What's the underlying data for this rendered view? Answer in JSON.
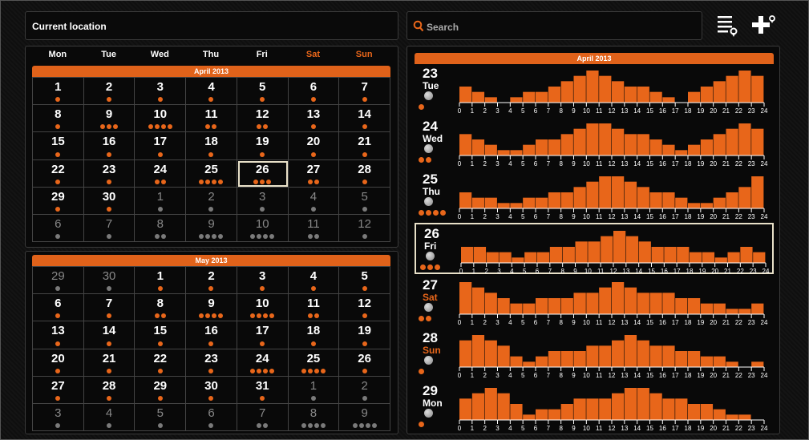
{
  "header": {
    "location_label": "Current location",
    "search_placeholder": "Search"
  },
  "calendar": {
    "weekdays": [
      "Mon",
      "Tue",
      "Wed",
      "Thu",
      "Fri",
      "Sat",
      "Sun"
    ],
    "weekend_color": "#e8661a",
    "april": {
      "title": "April 2013",
      "cells": [
        {
          "d": "1",
          "n": 1,
          "o": false
        },
        {
          "d": "2",
          "n": 1,
          "o": false
        },
        {
          "d": "3",
          "n": 1,
          "o": false
        },
        {
          "d": "4",
          "n": 1,
          "o": false
        },
        {
          "d": "5",
          "n": 1,
          "o": false
        },
        {
          "d": "6",
          "n": 1,
          "o": false
        },
        {
          "d": "7",
          "n": 1,
          "o": false
        },
        {
          "d": "8",
          "n": 1,
          "o": false
        },
        {
          "d": "9",
          "n": 3,
          "o": false
        },
        {
          "d": "10",
          "n": 4,
          "o": false
        },
        {
          "d": "11",
          "n": 2,
          "o": false
        },
        {
          "d": "12",
          "n": 2,
          "o": false
        },
        {
          "d": "13",
          "n": 1,
          "o": false
        },
        {
          "d": "14",
          "n": 1,
          "o": false
        },
        {
          "d": "15",
          "n": 1,
          "o": false
        },
        {
          "d": "16",
          "n": 1,
          "o": false
        },
        {
          "d": "17",
          "n": 1,
          "o": false
        },
        {
          "d": "18",
          "n": 1,
          "o": false
        },
        {
          "d": "19",
          "n": 1,
          "o": false
        },
        {
          "d": "20",
          "n": 1,
          "o": false
        },
        {
          "d": "21",
          "n": 1,
          "o": false
        },
        {
          "d": "22",
          "n": 1,
          "o": false
        },
        {
          "d": "23",
          "n": 1,
          "o": false
        },
        {
          "d": "24",
          "n": 2,
          "o": false
        },
        {
          "d": "25",
          "n": 4,
          "o": false
        },
        {
          "d": "26",
          "n": 3,
          "o": false,
          "sel": true
        },
        {
          "d": "27",
          "n": 2,
          "o": false
        },
        {
          "d": "28",
          "n": 1,
          "o": false
        },
        {
          "d": "29",
          "n": 1,
          "o": false
        },
        {
          "d": "30",
          "n": 1,
          "o": false
        },
        {
          "d": "1",
          "n": 1,
          "o": true
        },
        {
          "d": "2",
          "n": 1,
          "o": true
        },
        {
          "d": "3",
          "n": 1,
          "o": true
        },
        {
          "d": "4",
          "n": 1,
          "o": true
        },
        {
          "d": "5",
          "n": 1,
          "o": true
        },
        {
          "d": "6",
          "n": 1,
          "o": true
        },
        {
          "d": "7",
          "n": 1,
          "o": true
        },
        {
          "d": "8",
          "n": 2,
          "o": true
        },
        {
          "d": "9",
          "n": 4,
          "o": true
        },
        {
          "d": "10",
          "n": 4,
          "o": true
        },
        {
          "d": "11",
          "n": 2,
          "o": true
        },
        {
          "d": "12",
          "n": 1,
          "o": true
        }
      ]
    },
    "may": {
      "title": "May 2013",
      "cells": [
        {
          "d": "29",
          "n": 1,
          "o": true
        },
        {
          "d": "30",
          "n": 1,
          "o": true
        },
        {
          "d": "1",
          "n": 1,
          "o": false
        },
        {
          "d": "2",
          "n": 1,
          "o": false
        },
        {
          "d": "3",
          "n": 1,
          "o": false
        },
        {
          "d": "4",
          "n": 1,
          "o": false
        },
        {
          "d": "5",
          "n": 1,
          "o": false
        },
        {
          "d": "6",
          "n": 1,
          "o": false
        },
        {
          "d": "7",
          "n": 1,
          "o": false
        },
        {
          "d": "8",
          "n": 2,
          "o": false
        },
        {
          "d": "9",
          "n": 4,
          "o": false
        },
        {
          "d": "10",
          "n": 4,
          "o": false
        },
        {
          "d": "11",
          "n": 2,
          "o": false
        },
        {
          "d": "12",
          "n": 1,
          "o": false
        },
        {
          "d": "13",
          "n": 1,
          "o": false
        },
        {
          "d": "14",
          "n": 1,
          "o": false
        },
        {
          "d": "15",
          "n": 1,
          "o": false
        },
        {
          "d": "16",
          "n": 1,
          "o": false
        },
        {
          "d": "17",
          "n": 1,
          "o": false
        },
        {
          "d": "18",
          "n": 1,
          "o": false
        },
        {
          "d": "19",
          "n": 1,
          "o": false
        },
        {
          "d": "20",
          "n": 1,
          "o": false
        },
        {
          "d": "21",
          "n": 1,
          "o": false
        },
        {
          "d": "22",
          "n": 1,
          "o": false
        },
        {
          "d": "23",
          "n": 1,
          "o": false
        },
        {
          "d": "24",
          "n": 4,
          "o": false
        },
        {
          "d": "25",
          "n": 4,
          "o": false
        },
        {
          "d": "26",
          "n": 1,
          "o": false
        },
        {
          "d": "27",
          "n": 1,
          "o": false
        },
        {
          "d": "28",
          "n": 1,
          "o": false
        },
        {
          "d": "29",
          "n": 1,
          "o": false
        },
        {
          "d": "30",
          "n": 1,
          "o": false
        },
        {
          "d": "31",
          "n": 1,
          "o": false
        },
        {
          "d": "1",
          "n": 1,
          "o": true
        },
        {
          "d": "2",
          "n": 1,
          "o": true
        },
        {
          "d": "3",
          "n": 1,
          "o": true
        },
        {
          "d": "4",
          "n": 1,
          "o": true
        },
        {
          "d": "5",
          "n": 1,
          "o": true
        },
        {
          "d": "6",
          "n": 1,
          "o": true
        },
        {
          "d": "7",
          "n": 2,
          "o": true
        },
        {
          "d": "8",
          "n": 4,
          "o": true
        },
        {
          "d": "9",
          "n": 4,
          "o": true
        }
      ]
    }
  },
  "day_charts": {
    "title": "April 2013",
    "bar_color": "#e8661a",
    "hours": [
      "0",
      "1",
      "2",
      "3",
      "4",
      "5",
      "6",
      "7",
      "8",
      "9",
      "10",
      "11",
      "12",
      "13",
      "14",
      "15",
      "16",
      "17",
      "18",
      "19",
      "20",
      "21",
      "22",
      "23",
      "24"
    ],
    "days": [
      {
        "num": "23",
        "name": "Tue",
        "weekend": false,
        "dots": 1,
        "values": [
          3,
          2,
          1,
          0,
          1,
          2,
          2,
          3,
          4,
          5,
          6,
          5,
          4,
          3,
          3,
          2,
          1,
          0,
          2,
          3,
          4,
          5,
          6,
          5
        ]
      },
      {
        "num": "24",
        "name": "Wed",
        "weekend": false,
        "dots": 2,
        "values": [
          4,
          3,
          2,
          1,
          1,
          2,
          3,
          3,
          4,
          5,
          6,
          6,
          5,
          4,
          4,
          3,
          2,
          1,
          2,
          3,
          4,
          5,
          6,
          5
        ]
      },
      {
        "num": "25",
        "name": "Thu",
        "weekend": false,
        "dots": 4,
        "values": [
          3,
          2,
          2,
          1,
          1,
          2,
          2,
          3,
          3,
          4,
          5,
          6,
          6,
          5,
          4,
          3,
          3,
          2,
          1,
          1,
          2,
          3,
          4,
          6
        ]
      },
      {
        "num": "26",
        "name": "Fri",
        "weekend": false,
        "dots": 3,
        "values": [
          3,
          3,
          2,
          2,
          1,
          2,
          2,
          3,
          3,
          4,
          4,
          5,
          6,
          5,
          4,
          3,
          3,
          3,
          2,
          2,
          1,
          2,
          3,
          2
        ]
      },
      {
        "num": "27",
        "name": "Sat",
        "weekend": true,
        "dots": 2,
        "values": [
          6,
          5,
          4,
          3,
          2,
          2,
          3,
          3,
          3,
          4,
          4,
          5,
          6,
          5,
          4,
          4,
          4,
          3,
          3,
          2,
          2,
          1,
          1,
          2
        ]
      },
      {
        "num": "28",
        "name": "Sun",
        "weekend": true,
        "dots": 1,
        "values": [
          5,
          6,
          5,
          4,
          2,
          1,
          2,
          3,
          3,
          3,
          4,
          4,
          5,
          6,
          5,
          4,
          4,
          3,
          3,
          2,
          2,
          1,
          0,
          1
        ]
      },
      {
        "num": "29",
        "name": "Mon",
        "weekend": false,
        "dots": 1,
        "values": [
          4,
          5,
          6,
          5,
          3,
          1,
          2,
          2,
          3,
          4,
          4,
          4,
          5,
          6,
          6,
          5,
          4,
          4,
          3,
          3,
          2,
          1,
          1,
          0
        ]
      }
    ]
  }
}
